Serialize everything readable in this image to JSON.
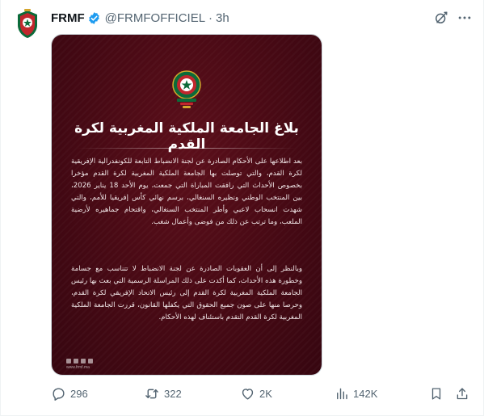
{
  "post": {
    "author": {
      "display_name": "FRMF",
      "handle": "@FRMFOFFICIEL",
      "verified": true,
      "avatar_icon": "frmf-crest-logo"
    },
    "separator": "·",
    "time": "3h",
    "header_icons": [
      "grok-icon",
      "more-icon"
    ]
  },
  "media": {
    "background_color": "#4a0a15",
    "logo_icon": "frmf-crest-logo",
    "title": "بلاغ الجامعة الملكية المغربية لكرة القدم",
    "paragraphs": [
      "بعد اطلاعها على الأحكام الصادرة عن لجنة الانضباط التابعة للكونفدرالية الإفريقية لكرة القدم، والتي توصلت بها الجامعة الملكية المغربية لكرة القدم مؤخرا بخصوص الأحداث التي رافقت المباراة التي جمعت، يوم الأحد 18 يناير 2026، بين المنتخب الوطني ونظيره السنغالي، برسم نهائي كأس إفريقيا للأمم، والتي شهدت انسحاب لاعبي وأطر المنتخب السنغالي، واقتحام جماهيره لأرضية الملعب، وما ترتب عن ذلك من فوضى وأعمال شغب.",
      "وبالنظر إلى أن العقوبات الصادرة عن لجنة الانضباط لا تتناسب مع جسامة وخطورة هذه الأحداث، كما أكدت على ذلك المراسلة الرسمية التي بعث بها رئيس الجامعة الملكية المغربية لكرة القدم إلى رئيس الاتحاد الإفريقي لكرة القدم، وحرصا منها على صون جميع الحقوق التي يكفلها القانون، قررت الجامعة الملكية المغربية لكرة القدم التقدم باستئناف لهذه الأحكام."
    ],
    "footer_text": "www.frmf.ma"
  },
  "actions": {
    "replies": "296",
    "reposts": "322",
    "likes": "2K",
    "views": "142K"
  },
  "colors": {
    "text_primary": "#0f1419",
    "text_secondary": "#536471",
    "verified_blue": "#1d9bf0",
    "crest_green": "#0b6b3a",
    "crest_red": "#c1272d"
  }
}
